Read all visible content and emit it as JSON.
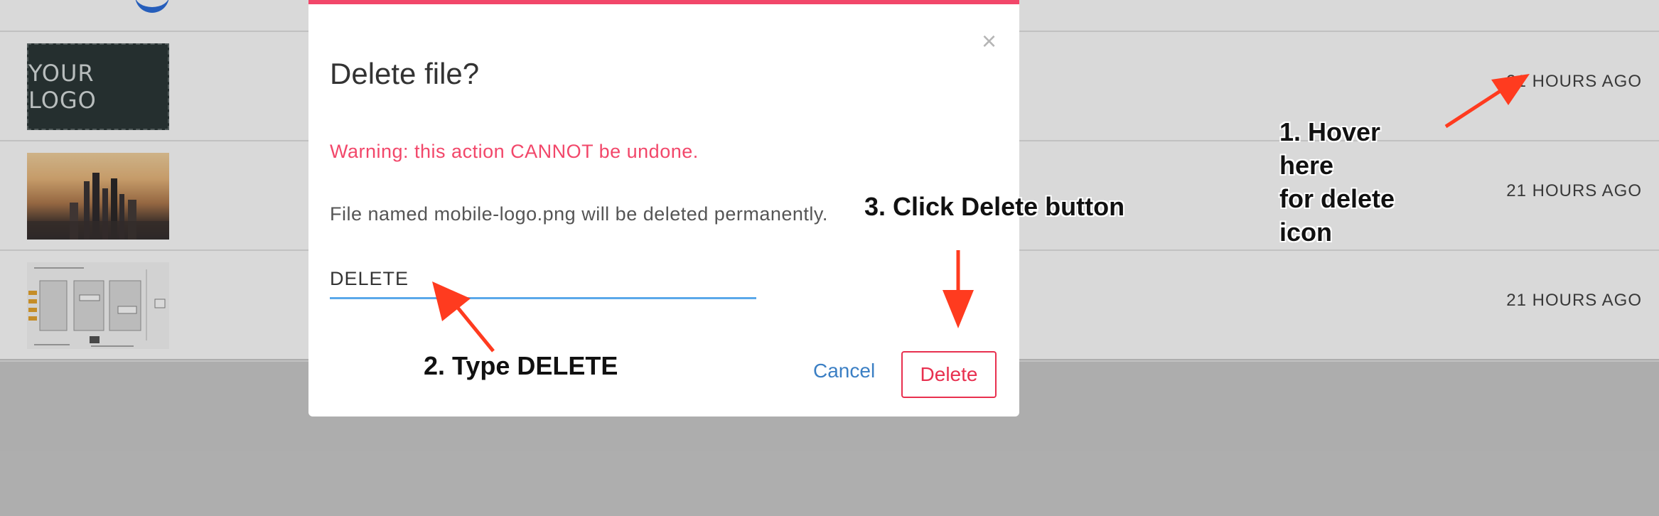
{
  "files": [
    {
      "thumbnail": "logo",
      "logo_text": "YOUR LOGO",
      "timestamp": "21 HOURS AGO"
    },
    {
      "thumbnail": "city-photo",
      "timestamp": "21 HOURS AGO"
    },
    {
      "thumbnail": "diagram",
      "timestamp": "21 HOURS AGO"
    }
  ],
  "modal": {
    "title": "Delete file?",
    "close_label": "×",
    "warning": "Warning: this action CANNOT be undone.",
    "file_info": "File named mobile-logo.png will be deleted permanently.",
    "input_value": "DELETE",
    "cancel_label": "Cancel",
    "delete_label": "Delete"
  },
  "annotations": {
    "step1": "1. Hover\nhere\nfor delete\nicon",
    "step2": "2. Type DELETE",
    "step3": "3. Click Delete button"
  },
  "colors": {
    "accent": "#f2476a",
    "link": "#3b7fc4",
    "input_underline": "#5aa8ea",
    "annotation_arrow": "#ff3b1f"
  }
}
